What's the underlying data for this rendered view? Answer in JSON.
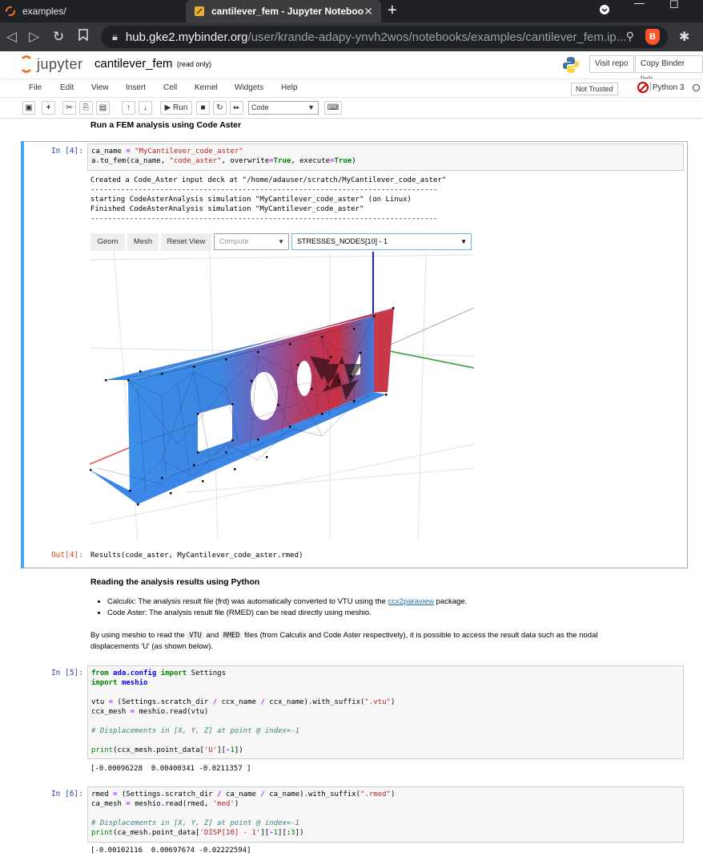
{
  "browser": {
    "tabs": [
      {
        "label": "examples/",
        "active": false
      },
      {
        "label": "cantilever_fem - Jupyter Noteboo",
        "active": true
      }
    ],
    "url_host": "hub.gke2.mybinder.org",
    "url_path": "/user/krande-adapy-ynvh2wos/notebooks/examples/cantilever_fem.ip..."
  },
  "jupyter": {
    "logo_text": "jupyter",
    "notebook_name": "cantilever_fem",
    "read_only": "(read only)",
    "visit_repo": "Visit repo",
    "copy_binder_link": "Copy Binder link",
    "menu": [
      "File",
      "Edit",
      "View",
      "Insert",
      "Cell",
      "Kernel",
      "Widgets",
      "Help"
    ],
    "not_trusted": "Not Trusted",
    "kernel": "Python 3",
    "run_label": "Run",
    "cell_type": "Code"
  },
  "cells": {
    "heading1": "Run a FEM analysis using Code Aster",
    "in4_prompt": "In [4]:",
    "out4_prompt": "Out[4]:",
    "out4_log": "Created a Code_Aster input deck at \"/home/adauser/scratch/MyCantilever_code_aster\"\n--------------------------------------------------------------------------------\nstarting CodeAsterAnalysis simulation \"MyCantilever_code_aster\" (on Linux)\nFinished CodeAsterAnalysis simulation \"MyCantilever_code_aster\"\n--------------------------------------------------------------------------------",
    "widget": {
      "geom": "Geom",
      "mesh": "Mesh",
      "reset_view": "Reset View",
      "compute": "Compute",
      "field": "STRESSES_NODES[10] - 1"
    },
    "out4_result": "Results(code_aster, MyCantilever_code_aster.rmed)",
    "heading2": "Reading the analysis results using Python",
    "bullet1_pre": "Calculix: The analysis result file (frd) was automatically converted to VTU using the ",
    "bullet1_link": "ccx2paraview",
    "bullet1_post": " package.",
    "bullet2": "Code Aster: The analysis result file (RMED) can be read directly using meshio.",
    "para_pre": "By using meshio to read the ",
    "para_code1": "VTU",
    "para_mid": " and ",
    "para_code2": "RMED",
    "para_post": " files (from Calculix and Code Aster respectively), it is possible to access the result data such as the nodal",
    "para_line2": "displacements 'U' (as shown below).",
    "in5_prompt": "In [5]:",
    "out5": "[-0.00096228  0.00400341 -0.0211357 ]",
    "in6_prompt": "In [6]:",
    "out6": "[-0.00102116  0.00697674 -0.02222594]"
  }
}
